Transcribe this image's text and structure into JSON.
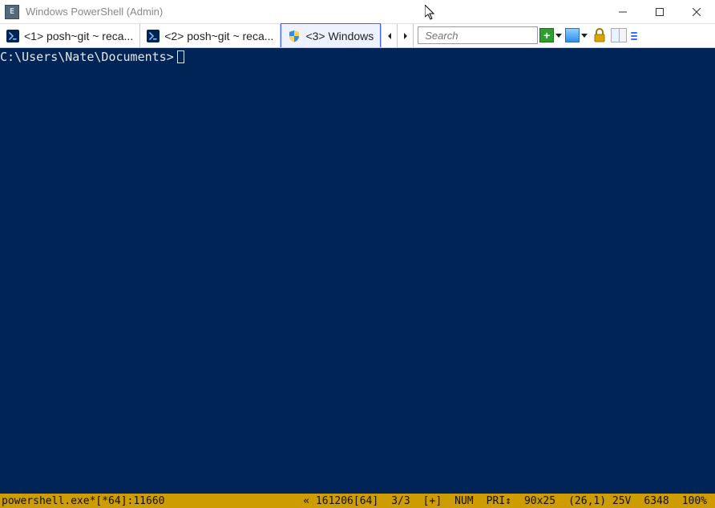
{
  "window": {
    "title": "Windows PowerShell (Admin)"
  },
  "tabs": [
    {
      "label": "<1> posh~git ~ reca..."
    },
    {
      "label": "<2> posh~git ~ reca..."
    },
    {
      "label": "<3> Windows"
    }
  ],
  "search": {
    "placeholder": "Search"
  },
  "terminal": {
    "prompt": "C:\\Users\\Nate\\Documents>"
  },
  "statusbar": {
    "process": "powershell.exe*[*64]:11660",
    "build": "« 161206[64]",
    "index": "3/3",
    "plus": "[+]",
    "num": "NUM",
    "pri": "PRI↕",
    "size": "90x25",
    "cursor": "(26,1) 25V",
    "mem": "6348",
    "zoom": "100%"
  }
}
